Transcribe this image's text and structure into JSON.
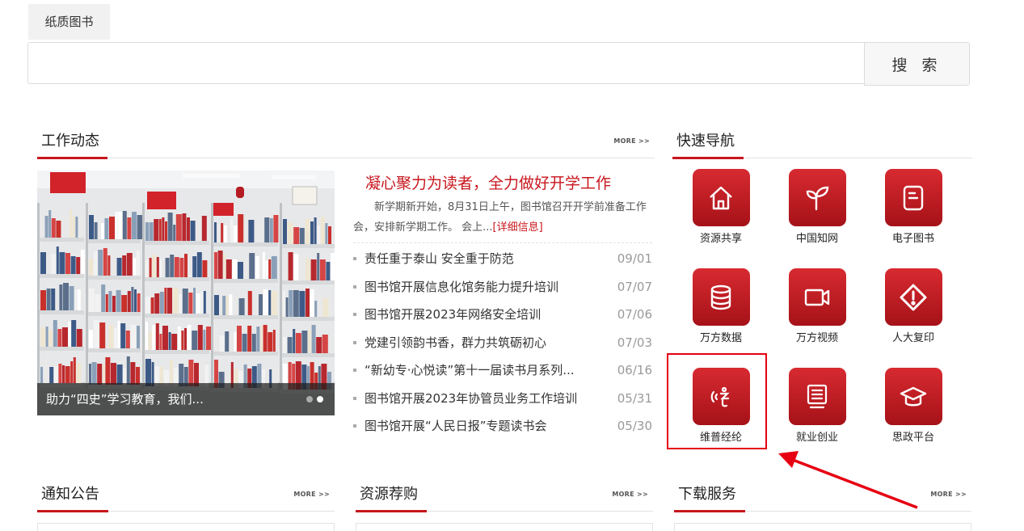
{
  "search": {
    "tab_label": "纸质图书",
    "input_value": "",
    "button_label": "搜 索"
  },
  "work_news": {
    "title": "工作动态",
    "more": "MORE >>",
    "photo_caption": "助力“四史”学习教育，我们...",
    "headline": "凝心聚力为读者，全力做好开学工作",
    "summary": "新学期新开始，8月31日上午，图书馆召开开学前准备工作会，安排新学期工作。 会上...",
    "detail_link": "[详细信息]",
    "items": [
      {
        "title": "责任重于泰山 安全重于防范",
        "date": "09/01"
      },
      {
        "title": "图书馆开展信息化馆务能力提升培训",
        "date": "07/07"
      },
      {
        "title": "图书馆开展2023年网络安全培训",
        "date": "07/06"
      },
      {
        "title": "党建引领韵书香，群力共筑砺初心",
        "date": "07/03"
      },
      {
        "title": "“新幼专·心悦读”第十一届读书月系列...",
        "date": "06/16"
      },
      {
        "title": "图书馆开展2023年协管员业务工作培训",
        "date": "05/31"
      },
      {
        "title": "图书馆开展“人民日报”专题读书会",
        "date": "05/30"
      }
    ]
  },
  "quick_nav": {
    "title": "快速导航",
    "items": [
      {
        "label": "资源共享",
        "icon": "home-icon"
      },
      {
        "label": "中国知网",
        "icon": "sprout-icon"
      },
      {
        "label": "电子图书",
        "icon": "ebook-icon"
      },
      {
        "label": "万方数据",
        "icon": "database-icon"
      },
      {
        "label": "万方视频",
        "icon": "video-camera-icon"
      },
      {
        "label": "人大复印",
        "icon": "diamond-direction-icon"
      },
      {
        "label": "维普经纶",
        "icon": "speaker-icon"
      },
      {
        "label": "就业创业",
        "icon": "monitor-icon"
      },
      {
        "label": "思政平台",
        "icon": "graduation-cap-icon"
      }
    ]
  },
  "notices": {
    "title": "通知公告",
    "more": "MORE >>"
  },
  "resources": {
    "title": "资源荐购",
    "more": "MORE >>"
  },
  "downloads": {
    "title": "下载服务",
    "more": "MORE >>"
  },
  "colors": {
    "accent": "#c8161d",
    "annotation": "#e60012"
  }
}
